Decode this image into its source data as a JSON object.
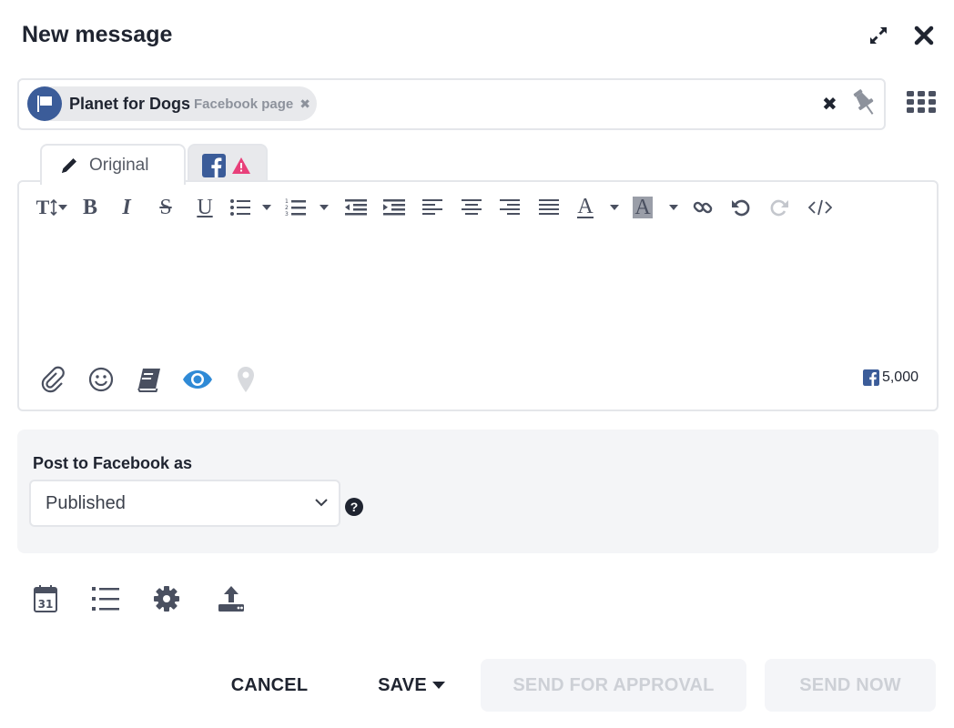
{
  "header": {
    "title": "New message",
    "expand_icon": "expand-icon",
    "close_icon": "close-icon"
  },
  "recipients": {
    "chip": {
      "name": "Planet for Dogs",
      "type": "Facebook page",
      "avatar_icon": "flag-icon",
      "remove_glyph": "✖"
    },
    "clear_glyph": "✖",
    "pin_icon": "pin-icon",
    "grid_icon": "grid-icon"
  },
  "tabs": [
    {
      "label": "Original",
      "icon": "pencil-icon",
      "active": true
    },
    {
      "label": "",
      "icon": "facebook-icon",
      "badge": "warning-icon",
      "active": false
    }
  ],
  "toolbar": {
    "font_size_label": "T",
    "bold_label": "B",
    "italic_label": "I",
    "strike_label": "S",
    "underline_label": "U",
    "font_color_label": "A",
    "bg_color_label": "A"
  },
  "editor": {
    "char_count": "5,000"
  },
  "post_as": {
    "label": "Post to Facebook as",
    "selected": "Published",
    "help_glyph": "?"
  },
  "bottom_icons": [
    "calendar-icon",
    "list-icon",
    "gear-icon",
    "upload-icon"
  ],
  "calendar_day": "31",
  "buttons": {
    "cancel": "CANCEL",
    "save": "SAVE",
    "send_for_approval": "SEND FOR APPROVAL",
    "send_now": "SEND NOW"
  },
  "colors": {
    "facebook_blue": "#3b5c99",
    "preview_eye": "#2f8ad6",
    "warning_pink": "#e8407a",
    "panel_bg": "#f4f5f7",
    "disabled_text": "#cdd0d6"
  }
}
